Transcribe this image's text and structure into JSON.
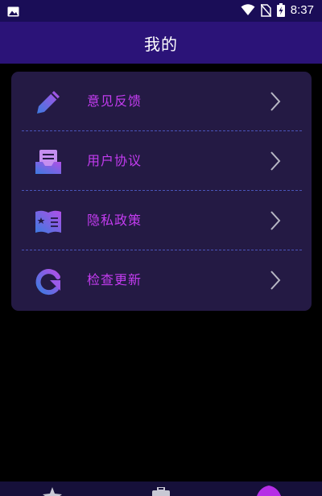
{
  "status_bar": {
    "time": "8:37",
    "icons": [
      "image-icon",
      "wifi-icon",
      "no-sim-icon",
      "battery-charging-icon"
    ]
  },
  "header": {
    "title": "我的"
  },
  "menu": {
    "items": [
      {
        "label": "意见反馈",
        "icon": "edit-pencil-icon"
      },
      {
        "label": "用户协议",
        "icon": "document-inbox-icon"
      },
      {
        "label": "隐私政策",
        "icon": "privacy-book-icon"
      },
      {
        "label": "检查更新",
        "icon": "refresh-update-icon"
      }
    ]
  },
  "bottom_nav": {
    "items": [
      {
        "icon": "star-icon"
      },
      {
        "icon": "toolbox-icon"
      },
      {
        "icon": "profile-icon",
        "active": true
      }
    ]
  },
  "colors": {
    "status_bar": "#1a0d57",
    "app_bar": "#2b1378",
    "card": "#241a44",
    "label": "#c33cf0",
    "divider": "#4a54b8",
    "background": "#000000"
  }
}
